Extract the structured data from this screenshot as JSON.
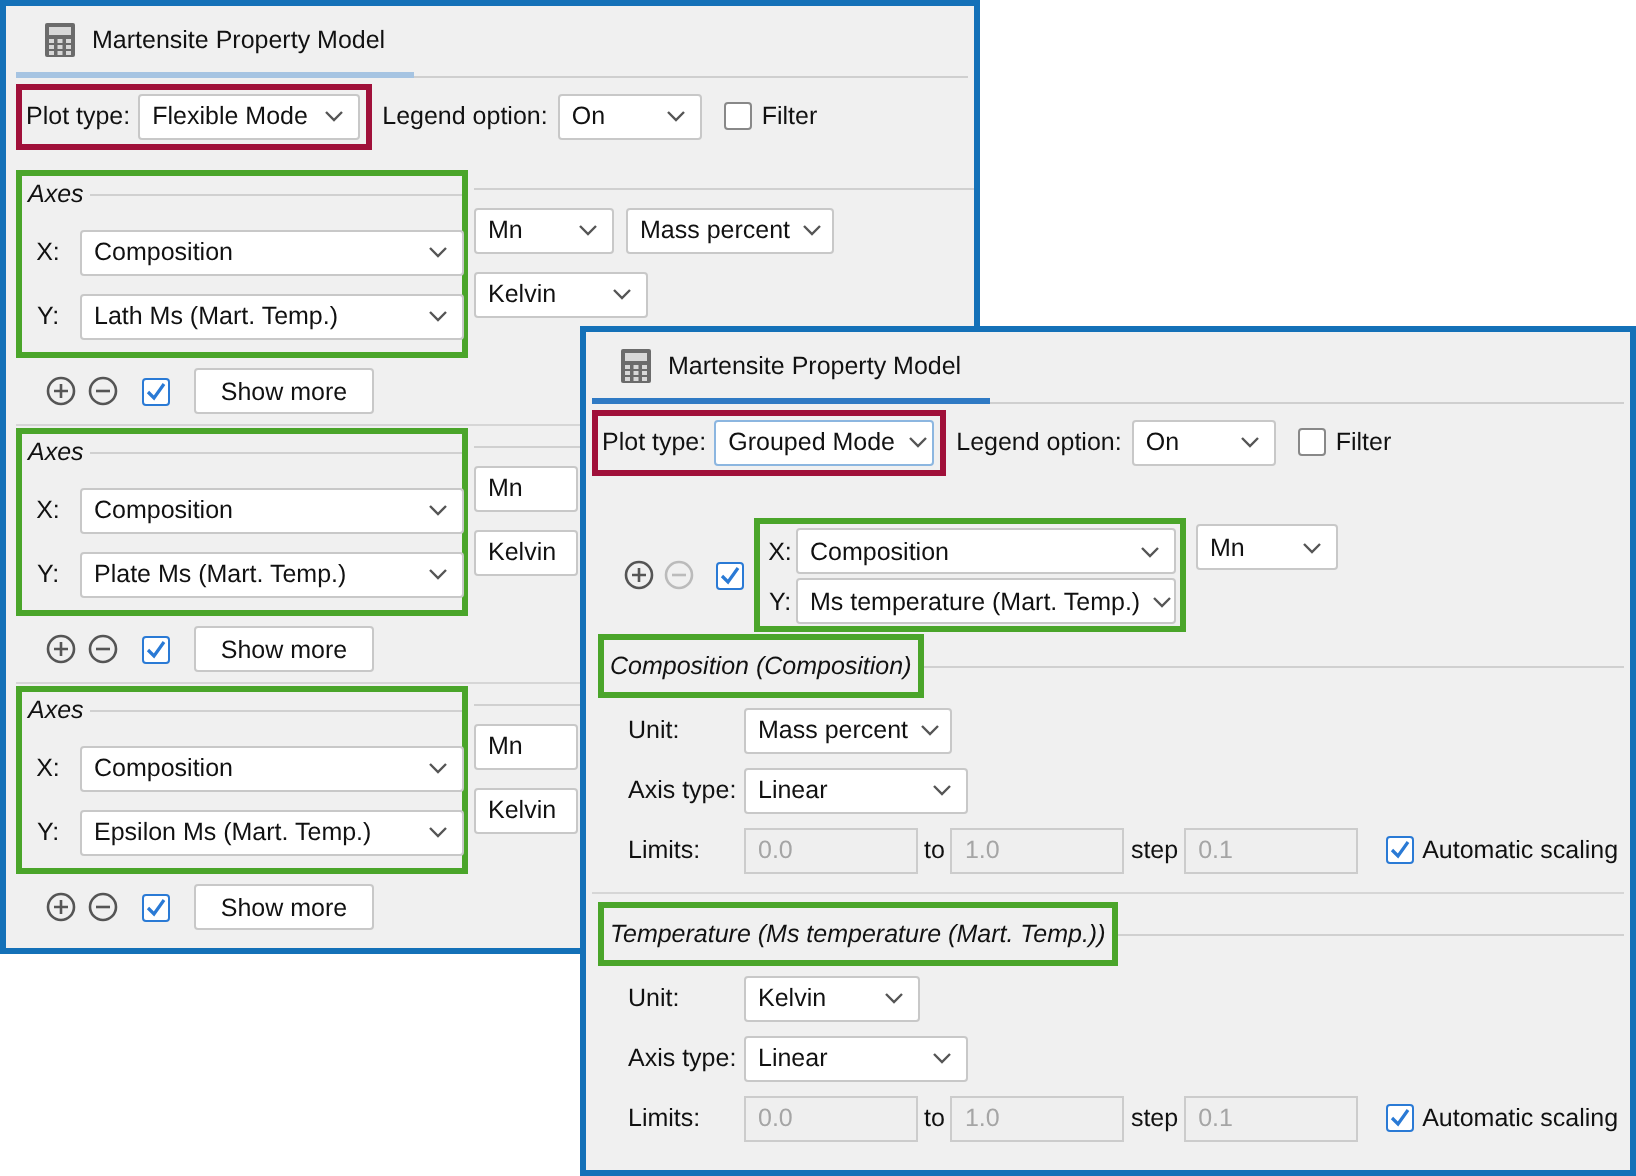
{
  "flexible_window": {
    "title": "Martensite Property Model",
    "plot_type": {
      "label": "Plot type:",
      "value": "Flexible Mode"
    },
    "legend_option": {
      "label": "Legend option:",
      "value": "On"
    },
    "filter": {
      "label": "Filter",
      "checked": false
    },
    "axes_groups": [
      {
        "legend": "Axes",
        "x": {
          "label": "X:",
          "quantity": "Composition",
          "extra": [
            "Mn",
            "Mass percent"
          ]
        },
        "y": {
          "label": "Y:",
          "quantity": "Lath Ms (Mart. Temp.)",
          "extra": [
            "Kelvin"
          ]
        },
        "checked": true,
        "button": "Show more"
      },
      {
        "legend": "Axes",
        "x": {
          "label": "X:",
          "quantity": "Composition",
          "extra": [
            "Mn"
          ]
        },
        "y": {
          "label": "Y:",
          "quantity": "Plate Ms (Mart. Temp.)",
          "extra": [
            "Kelvin"
          ]
        },
        "checked": true,
        "button": "Show more"
      },
      {
        "legend": "Axes",
        "x": {
          "label": "X:",
          "quantity": "Composition",
          "extra": [
            "Mn"
          ]
        },
        "y": {
          "label": "Y:",
          "quantity": "Epsilon Ms (Mart. Temp.)",
          "extra": [
            "Kelvin"
          ]
        },
        "checked": true,
        "button": "Show more"
      }
    ]
  },
  "grouped_window": {
    "title": "Martensite Property Model",
    "plot_type": {
      "label": "Plot type:",
      "value": "Grouped Mode"
    },
    "legend_option": {
      "label": "Legend option:",
      "value": "On"
    },
    "filter": {
      "label": "Filter",
      "checked": false
    },
    "axes": {
      "remove_disabled": true,
      "checked": true,
      "x": {
        "label": "X:",
        "quantity": "Composition",
        "extra": [
          "Mn"
        ]
      },
      "y": {
        "label": "Y:",
        "quantity": "Ms temperature (Mart. Temp.)"
      }
    },
    "sections": [
      {
        "title": "Composition (Composition)",
        "unit_label": "Unit:",
        "unit": "Mass percent",
        "axis_type_label": "Axis type:",
        "axis_type": "Linear",
        "limits_label": "Limits:",
        "from": "0.0",
        "to_label": "to",
        "to": "1.0",
        "step_label": "step",
        "step": "0.1",
        "limits_disabled": true,
        "auto_label": "Automatic scaling",
        "auto_checked": true
      },
      {
        "title": "Temperature (Ms temperature (Mart. Temp.))",
        "unit_label": "Unit:",
        "unit": "Kelvin",
        "axis_type_label": "Axis type:",
        "axis_type": "Linear",
        "limits_label": "Limits:",
        "from": "0.0",
        "to_label": "to",
        "to": "1.0",
        "step_label": "step",
        "step": "0.1",
        "limits_disabled": true,
        "auto_label": "Automatic scaling",
        "auto_checked": true
      }
    ]
  }
}
